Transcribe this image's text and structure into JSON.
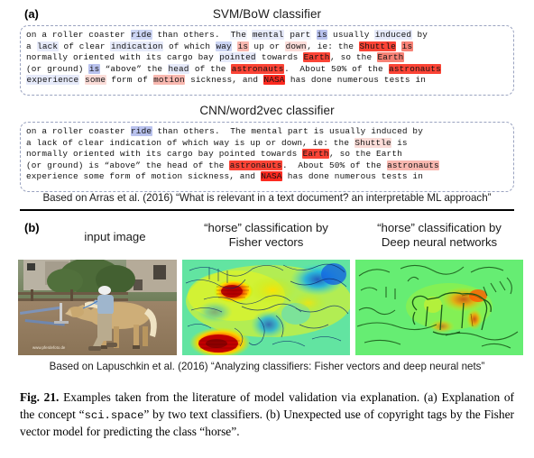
{
  "figure": {
    "caption_label": "Fig. 21.",
    "caption_part1": " Examples taken from the literature of model validation via explanation. (a) Explanation of the concept “",
    "caption_mono": "sci.space",
    "caption_part2": "” by two text classifiers. (b) Unexpected use of copyright tags by the Fisher vector model for predicting the class “horse”."
  },
  "panel_a": {
    "label": "(a)",
    "classifier_1_title": "SVM/BoW classifier",
    "classifier_2_title": "CNN/word2vec classifier",
    "citation": "Based on Arras et al. (2016) “What is relevant in a text document? an interpretable ML approach”",
    "svm_lines": [
      [
        {
          "t": "on a roller coaster ",
          "c": "none"
        },
        {
          "t": "ride",
          "c": "blue-3"
        },
        {
          "t": " than others.  ",
          "c": "none"
        },
        {
          "t": "The",
          "c": "blue-1"
        },
        {
          "t": " ",
          "c": "none"
        },
        {
          "t": "mental",
          "c": "blue-2"
        },
        {
          "t": " ",
          "c": "none"
        },
        {
          "t": "part",
          "c": "blue-1"
        },
        {
          "t": " ",
          "c": "none"
        },
        {
          "t": "is",
          "c": "blue-4"
        },
        {
          "t": " usually ",
          "c": "none"
        },
        {
          "t": "induced",
          "c": "blue-2"
        },
        {
          "t": " by",
          "c": "none"
        }
      ],
      [
        {
          "t": "a ",
          "c": "none"
        },
        {
          "t": "lack",
          "c": "blue-2"
        },
        {
          "t": " of clear ",
          "c": "none"
        },
        {
          "t": "indication",
          "c": "blue-2"
        },
        {
          "t": " of which ",
          "c": "none"
        },
        {
          "t": "way",
          "c": "blue-3"
        },
        {
          "t": " ",
          "c": "none"
        },
        {
          "t": "is",
          "c": "red-3"
        },
        {
          "t": " up or ",
          "c": "none"
        },
        {
          "t": "down",
          "c": "red-2"
        },
        {
          "t": ", ie: the ",
          "c": "none"
        },
        {
          "t": "Shuttle",
          "c": "red-5"
        },
        {
          "t": " ",
          "c": "none"
        },
        {
          "t": "is",
          "c": "red-4"
        }
      ],
      [
        {
          "t": "normally oriented with its cargo bay ",
          "c": "none"
        },
        {
          "t": "pointed",
          "c": "blue-2"
        },
        {
          "t": " towards ",
          "c": "none"
        },
        {
          "t": "Earth",
          "c": "red-5"
        },
        {
          "t": ", so the ",
          "c": "none"
        },
        {
          "t": "Earth",
          "c": "red-4"
        }
      ],
      [
        {
          "t": "(or ground) ",
          "c": "none"
        },
        {
          "t": "is",
          "c": "blue-4"
        },
        {
          "t": " “above” the ",
          "c": "none"
        },
        {
          "t": "head",
          "c": "blue-2"
        },
        {
          "t": " of the ",
          "c": "none"
        },
        {
          "t": "astronauts",
          "c": "red-5"
        },
        {
          "t": ".  About 50% of the ",
          "c": "none"
        },
        {
          "t": "astronauts",
          "c": "red-5"
        }
      ],
      [
        {
          "t": "experience",
          "c": "blue-2"
        },
        {
          "t": " ",
          "c": "none"
        },
        {
          "t": "some",
          "c": "red-2"
        },
        {
          "t": " form of ",
          "c": "none"
        },
        {
          "t": "motion",
          "c": "red-3"
        },
        {
          "t": " sickness, and ",
          "c": "none"
        },
        {
          "t": "NASA",
          "c": "red-6"
        },
        {
          "t": " has done numerous tests in",
          "c": "none"
        }
      ]
    ],
    "cnn_lines": [
      [
        {
          "t": "on a roller coaster ",
          "c": "none"
        },
        {
          "t": "ride",
          "c": "blue-4"
        },
        {
          "t": " than others.  The mental part is usually induced by",
          "c": "none"
        }
      ],
      [
        {
          "t": "a lack of clear indication of which way is up or down, ie: the ",
          "c": "none"
        },
        {
          "t": "Shuttle",
          "c": "red-2"
        },
        {
          "t": " is",
          "c": "none"
        }
      ],
      [
        {
          "t": "normally oriented with its cargo bay pointed towards ",
          "c": "none"
        },
        {
          "t": "Earth",
          "c": "red-5"
        },
        {
          "t": ", so the Earth",
          "c": "none"
        }
      ],
      [
        {
          "t": "(or ground) is “above” the head of the ",
          "c": "none"
        },
        {
          "t": "astronauts",
          "c": "red-5"
        },
        {
          "t": ".  About 50% of the ",
          "c": "none"
        },
        {
          "t": "astronauts",
          "c": "red-3"
        }
      ],
      [
        {
          "t": "experience some form of motion sickness, and ",
          "c": "none"
        },
        {
          "t": "NASA",
          "c": "red-6"
        },
        {
          "t": " has done numerous tests in",
          "c": "none"
        }
      ]
    ]
  },
  "panel_b": {
    "label": "(b)",
    "columns": [
      {
        "title": "input image",
        "name": "input-image"
      },
      {
        "title": "“horse” classification by\nFisher vectors",
        "name": "fisher-heatmap"
      },
      {
        "title": "“horse” classification by\nDeep neural networks",
        "name": "dnn-heatmap"
      }
    ],
    "citation": "Based on Lapuschkin et al. (2016) “Analyzing classifiers: Fisher vectors and deep neural nets”",
    "input_image_watermark": "www.pferdefoto.de"
  },
  "colors": {
    "highlight_blue_weak": "#e8ecf8",
    "highlight_blue_strong": "#b9c2ee",
    "highlight_red_weak": "#fbe6e4",
    "highlight_red_strong": "#fd2a20",
    "box_border": "#9aa3c0",
    "divider": "#000000",
    "heat_low": "#2b6fd4",
    "heat_mid": "#6fe06f",
    "heat_high": "#d81000"
  }
}
